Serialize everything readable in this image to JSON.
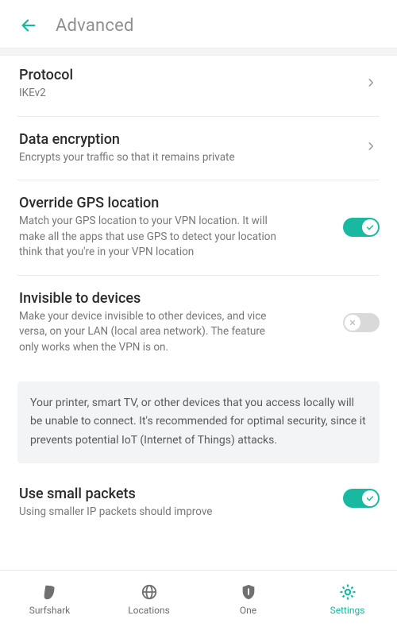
{
  "header": {
    "title": "Advanced"
  },
  "rows": {
    "protocol": {
      "title": "Protocol",
      "sub": "IKEv2"
    },
    "encryption": {
      "title": "Data encryption",
      "sub": "Encrypts your traffic so that it remains private"
    },
    "gps": {
      "title": "Override GPS location",
      "sub": "Match your GPS location to your VPN location. It will make all the apps that use GPS to detect your location think that you're in your VPN location",
      "on": true
    },
    "invisible": {
      "title": "Invisible to devices",
      "sub": "Make your device invisible to other devices, and vice versa, on your LAN (local area network). The feature only works when the VPN is on.",
      "on": false
    },
    "info": "Your printer, smart TV, or other devices that you access locally will be unable to connect. It's recommended for optimal security, since it prevents potential IoT (Internet of Things) attacks.",
    "packets": {
      "title": "Use small packets",
      "sub": "Using smaller IP packets should improve",
      "on": true
    }
  },
  "nav": {
    "items": [
      {
        "label": "Surfshark"
      },
      {
        "label": "Locations"
      },
      {
        "label": "One"
      },
      {
        "label": "Settings"
      }
    ],
    "active": 3
  },
  "colors": {
    "accent": "#18b9a0"
  }
}
